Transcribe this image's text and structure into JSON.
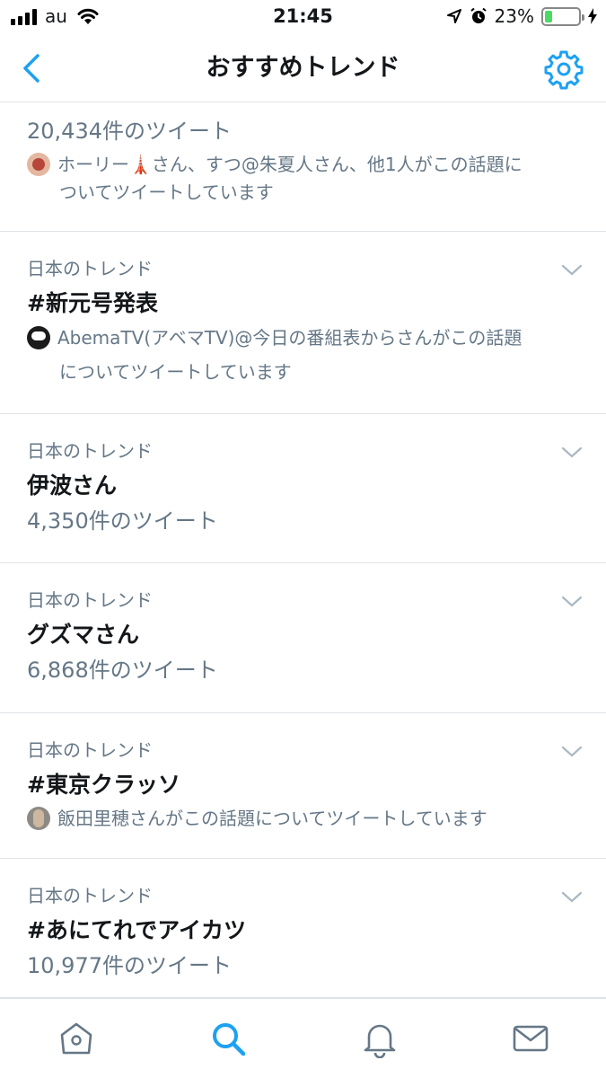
{
  "status_bar": {
    "carrier": "au",
    "time": "21:45",
    "battery_percent": "23%",
    "battery_level": 0.23,
    "battery_color": "#4cd964"
  },
  "nav": {
    "back_icon": "chevron-left-icon",
    "title": "おすすめトレンド",
    "settings_icon": "gear-icon",
    "accent_color": "#1da1f2"
  },
  "trends": [
    {
      "tweet_count": "20,434件のツイート",
      "tweeted_by_prefix": "ホーリー",
      "tweeted_by_emoji": "🗼",
      "tweeted_by_suffix": "さん、すつ@朱夏人さん、他1人がこの話題に",
      "tweeted_by_line2": "ついてツイートしています"
    },
    {
      "context": "日本のトレンド",
      "name": "#新元号発表",
      "tweeted_by_line1": "AbemaTV(アベマTV)@今日の番組表からさんがこの話題",
      "tweeted_by_line2": "についてツイートしています"
    },
    {
      "context": "日本のトレンド",
      "name": "伊波さん",
      "tweet_count": "4,350件のツイート"
    },
    {
      "context": "日本のトレンド",
      "name": "グズマさん",
      "tweet_count": "6,868件のツイート"
    },
    {
      "context": "日本のトレンド",
      "name": "#東京クラッソ",
      "tweeted_by_line1": "飯田里穂さんがこの話題についてツイートしています"
    },
    {
      "context": "日本のトレンド",
      "name": "#あにてれでアイカツ",
      "tweet_count": "10,977件のツイート"
    }
  ],
  "tab_bar": {
    "items": [
      "home-icon",
      "search-icon",
      "notifications-icon",
      "messages-icon"
    ],
    "active": "search-icon"
  }
}
